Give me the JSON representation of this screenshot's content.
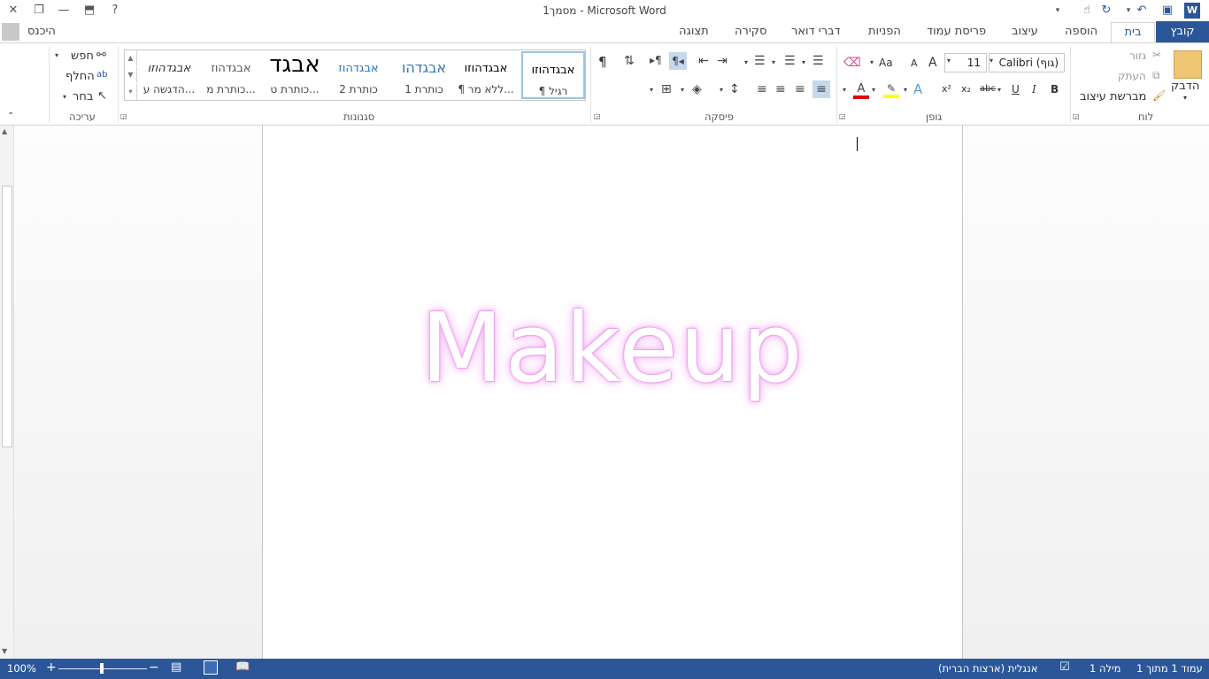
{
  "window": {
    "title": "מסמך1 - Microsoft Word",
    "help": "?",
    "signin": "היכנס"
  },
  "tabs": {
    "file": "קובץ",
    "home": "בית",
    "insert": "הוספה",
    "design": "עיצוב",
    "layout": "פריסת עמוד",
    "references": "הפניות",
    "mailings": "דברי דואר",
    "review": "סקירה",
    "view": "תצוגה"
  },
  "clipboard": {
    "label": "לוח",
    "paste": "הדבק",
    "cut": "גזור",
    "copy": "העתק",
    "format_painter": "מברשת עיצוב"
  },
  "font": {
    "label": "גופן",
    "name": "Calibri (גוף)",
    "size": "11",
    "bold": "B",
    "italic": "I",
    "underline": "U",
    "strike": "abc",
    "subscript": "x₂",
    "superscript": "x²",
    "text_effects": "A",
    "change_case": "Aa",
    "grow": "A",
    "shrink": "A",
    "font_color_hex": "#e00000",
    "highlight_hex": "#ffff00"
  },
  "paragraph": {
    "label": "פיסקה",
    "pilcrow": "¶"
  },
  "styles": {
    "label": "סגנונות",
    "items": [
      {
        "sample": "אבגדהוזו",
        "name": "¶ רגיל"
      },
      {
        "sample": "אבגדהוזו",
        "name": "¶ ללא מר..."
      },
      {
        "sample": "אבגדהו",
        "name": "כותרת 1"
      },
      {
        "sample": "אבגדהוז",
        "name": "כותרת 2"
      },
      {
        "sample": "אבגד",
        "name": "כותרת ט..."
      },
      {
        "sample": "אבגדהוז",
        "name": "כותרת מ..."
      },
      {
        "sample": "אבגדהוזו",
        "name": "הדגשה ע..."
      }
    ]
  },
  "editing": {
    "label": "עריכה",
    "find": "חפש",
    "replace": "החלף",
    "select": "בחר"
  },
  "document": {
    "wordart_text": "Makeup"
  },
  "status": {
    "page": "עמוד 1 מתוך 1",
    "words": "מילה 1",
    "language": "אנגלית (ארצות הברית)",
    "zoom": "100%"
  },
  "colors": {
    "accent": "#2b579a",
    "wordart_glow": "#f0a6f0"
  }
}
